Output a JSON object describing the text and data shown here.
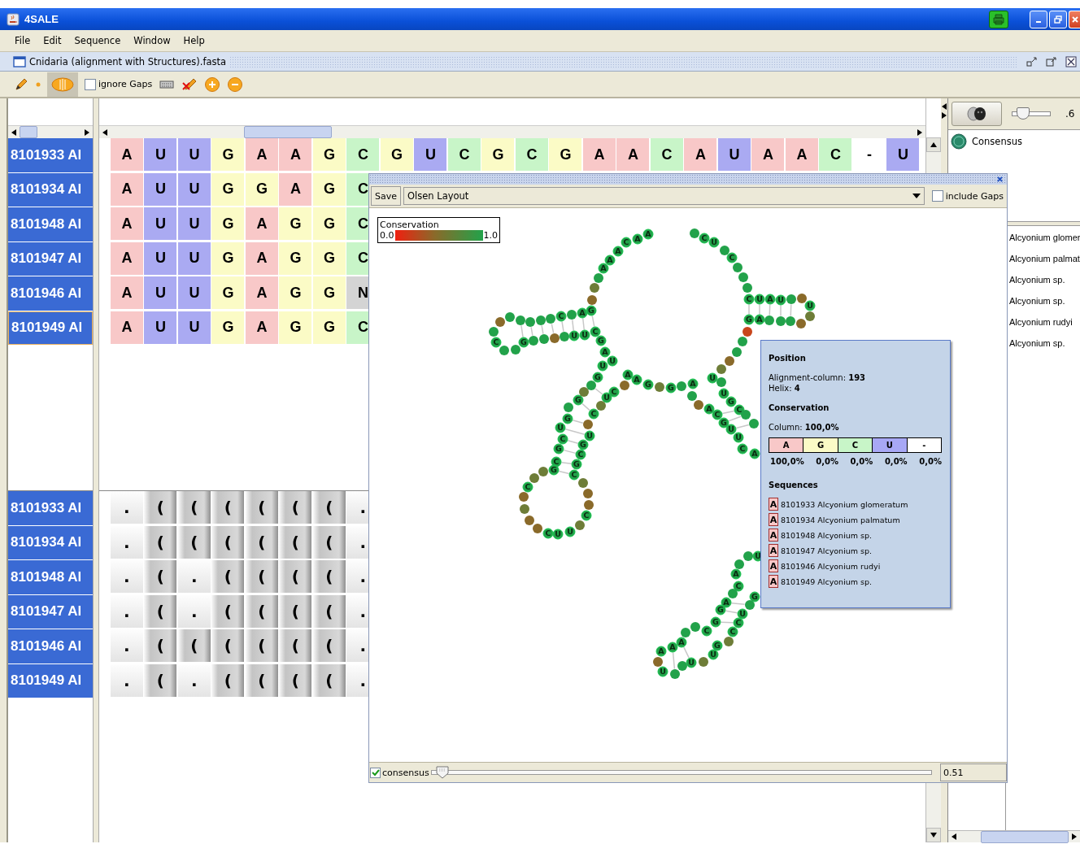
{
  "window": {
    "title": "4SALE"
  },
  "menu": [
    "File",
    "Edit",
    "Sequence",
    "Window",
    "Help"
  ],
  "document": {
    "title": "Cnidaria (alignment with Structures).fasta"
  },
  "toolbar": {
    "ignore_gaps": {
      "label": "ignore Gaps",
      "checked": false
    }
  },
  "sequences": [
    {
      "name": "8101933 Al",
      "selected": false,
      "cells": [
        {
          "base": "A",
          "color": "#f8c8c8"
        },
        {
          "base": "U",
          "color": "#aaaaf2"
        },
        {
          "base": "U",
          "color": "#aaaaf2"
        },
        {
          "base": "G",
          "color": "#fbfbc6"
        },
        {
          "base": "A",
          "color": "#f8c8c8"
        },
        {
          "base": "A",
          "color": "#f8c8c8"
        },
        {
          "base": "G",
          "color": "#fbfbc6"
        },
        {
          "base": "C",
          "color": "#c8f5c8"
        },
        {
          "base": "G",
          "color": "#fbfbc6"
        },
        {
          "base": "U",
          "color": "#aaaaf2"
        },
        {
          "base": "C",
          "color": "#c8f5c8"
        },
        {
          "base": "G",
          "color": "#fbfbc6"
        },
        {
          "base": "C",
          "color": "#c8f5c8"
        },
        {
          "base": "G",
          "color": "#fbfbc6"
        },
        {
          "base": "A",
          "color": "#f8c8c8"
        },
        {
          "base": "A",
          "color": "#f8c8c8"
        },
        {
          "base": "C",
          "color": "#c8f5c8"
        },
        {
          "base": "A",
          "color": "#f8c8c8"
        },
        {
          "base": "U",
          "color": "#aaaaf2"
        },
        {
          "base": "A",
          "color": "#f8c8c8"
        },
        {
          "base": "A",
          "color": "#f8c8c8"
        },
        {
          "base": "C",
          "color": "#c8f5c8"
        },
        {
          "base": "-",
          "color": "#ffffff"
        },
        {
          "base": "U",
          "color": "#aaaaf2"
        }
      ]
    },
    {
      "name": "8101934 Al",
      "selected": false,
      "cells": [
        {
          "base": "A",
          "color": "#f8c8c8"
        },
        {
          "base": "U",
          "color": "#aaaaf2"
        },
        {
          "base": "U",
          "color": "#aaaaf2"
        },
        {
          "base": "G",
          "color": "#fbfbc6"
        },
        {
          "base": "G",
          "color": "#fbfbc6"
        },
        {
          "base": "A",
          "color": "#f8c8c8"
        },
        {
          "base": "G",
          "color": "#fbfbc6"
        },
        {
          "base": "C",
          "color": "#c8f5c8"
        }
      ]
    },
    {
      "name": "8101948 Al",
      "selected": false,
      "cells": [
        {
          "base": "A",
          "color": "#f8c8c8"
        },
        {
          "base": "U",
          "color": "#aaaaf2"
        },
        {
          "base": "U",
          "color": "#aaaaf2"
        },
        {
          "base": "G",
          "color": "#fbfbc6"
        },
        {
          "base": "A",
          "color": "#f8c8c8"
        },
        {
          "base": "G",
          "color": "#fbfbc6"
        },
        {
          "base": "G",
          "color": "#fbfbc6"
        },
        {
          "base": "C",
          "color": "#c8f5c8"
        }
      ]
    },
    {
      "name": "8101947 Al",
      "selected": false,
      "cells": [
        {
          "base": "A",
          "color": "#f8c8c8"
        },
        {
          "base": "U",
          "color": "#aaaaf2"
        },
        {
          "base": "U",
          "color": "#aaaaf2"
        },
        {
          "base": "G",
          "color": "#fbfbc6"
        },
        {
          "base": "A",
          "color": "#f8c8c8"
        },
        {
          "base": "G",
          "color": "#fbfbc6"
        },
        {
          "base": "G",
          "color": "#fbfbc6"
        },
        {
          "base": "C",
          "color": "#c8f5c8"
        }
      ]
    },
    {
      "name": "8101946 Al",
      "selected": false,
      "cells": [
        {
          "base": "A",
          "color": "#f8c8c8"
        },
        {
          "base": "U",
          "color": "#aaaaf2"
        },
        {
          "base": "U",
          "color": "#aaaaf2"
        },
        {
          "base": "G",
          "color": "#fbfbc6"
        },
        {
          "base": "A",
          "color": "#f8c8c8"
        },
        {
          "base": "G",
          "color": "#fbfbc6"
        },
        {
          "base": "G",
          "color": "#fbfbc6"
        },
        {
          "base": "N",
          "color": "#d4d4d4"
        }
      ]
    },
    {
      "name": "8101949 Al",
      "selected": true,
      "cells": [
        {
          "base": "A",
          "color": "#f8c8c8"
        },
        {
          "base": "U",
          "color": "#aaaaf2"
        },
        {
          "base": "U",
          "color": "#aaaaf2"
        },
        {
          "base": "G",
          "color": "#fbfbc6"
        },
        {
          "base": "A",
          "color": "#f8c8c8"
        },
        {
          "base": "G",
          "color": "#fbfbc6"
        },
        {
          "base": "G",
          "color": "#fbfbc6"
        },
        {
          "base": "C",
          "color": "#c8f5c8"
        }
      ]
    }
  ],
  "structures": [
    {
      "name": "8101933 Al",
      "cells": [
        {
          "symbol": ".",
          "kind": "dot"
        },
        {
          "symbol": "(",
          "kind": "paren"
        },
        {
          "symbol": "(",
          "kind": "paren"
        },
        {
          "symbol": "(",
          "kind": "paren"
        },
        {
          "symbol": "(",
          "kind": "paren"
        },
        {
          "symbol": "(",
          "kind": "paren"
        },
        {
          "symbol": "(",
          "kind": "paren"
        },
        {
          "symbol": ".",
          "kind": "dot"
        }
      ]
    },
    {
      "name": "8101934 Al",
      "cells": [
        {
          "symbol": ".",
          "kind": "dot"
        },
        {
          "symbol": "(",
          "kind": "paren"
        },
        {
          "symbol": "(",
          "kind": "paren"
        },
        {
          "symbol": "(",
          "kind": "paren"
        },
        {
          "symbol": "(",
          "kind": "paren"
        },
        {
          "symbol": "(",
          "kind": "paren"
        },
        {
          "symbol": "(",
          "kind": "paren"
        },
        {
          "symbol": ".",
          "kind": "dot"
        }
      ]
    },
    {
      "name": "8101948 Al",
      "cells": [
        {
          "symbol": ".",
          "kind": "dot"
        },
        {
          "symbol": "(",
          "kind": "paren"
        },
        {
          "symbol": ".",
          "kind": "dot"
        },
        {
          "symbol": "(",
          "kind": "paren"
        },
        {
          "symbol": "(",
          "kind": "paren"
        },
        {
          "symbol": "(",
          "kind": "paren"
        },
        {
          "symbol": "(",
          "kind": "paren"
        },
        {
          "symbol": ".",
          "kind": "dot"
        }
      ]
    },
    {
      "name": "8101947 Al",
      "cells": [
        {
          "symbol": ".",
          "kind": "dot"
        },
        {
          "symbol": "(",
          "kind": "paren"
        },
        {
          "symbol": ".",
          "kind": "dot"
        },
        {
          "symbol": "(",
          "kind": "paren"
        },
        {
          "symbol": "(",
          "kind": "paren"
        },
        {
          "symbol": "(",
          "kind": "paren"
        },
        {
          "symbol": "(",
          "kind": "paren"
        },
        {
          "symbol": ".",
          "kind": "dot"
        }
      ]
    },
    {
      "name": "8101946 Al",
      "cells": [
        {
          "symbol": ".",
          "kind": "dot"
        },
        {
          "symbol": "(",
          "kind": "paren"
        },
        {
          "symbol": "(",
          "kind": "paren"
        },
        {
          "symbol": "(",
          "kind": "paren"
        },
        {
          "symbol": "(",
          "kind": "paren"
        },
        {
          "symbol": "(",
          "kind": "paren"
        },
        {
          "symbol": "(",
          "kind": "paren"
        },
        {
          "symbol": ".",
          "kind": "dot"
        }
      ]
    },
    {
      "name": "8101949 Al",
      "cells": [
        {
          "symbol": ".",
          "kind": "dot"
        },
        {
          "symbol": "(",
          "kind": "paren"
        },
        {
          "symbol": ".",
          "kind": "dot"
        },
        {
          "symbol": "(",
          "kind": "paren"
        },
        {
          "symbol": "(",
          "kind": "paren"
        },
        {
          "symbol": "(",
          "kind": "paren"
        },
        {
          "symbol": "(",
          "kind": "paren"
        },
        {
          "symbol": ".",
          "kind": "dot"
        }
      ]
    }
  ],
  "right_panel": {
    "slider": {
      "level": 0.2
    },
    "value": ".6",
    "consensus": "Consensus",
    "species": [
      "Alcyonium glomer",
      "Alcyonium palmat",
      "Alcyonium sp.",
      "Alcyonium sp.",
      "Alcyonium rudyi",
      "Alcyonium sp."
    ]
  },
  "structure_window": {
    "save": "Save",
    "layout": "Olsen Layout",
    "include_gaps": {
      "label": "include Gaps",
      "checked": false
    },
    "legend": {
      "title": "Conservation",
      "min": "0.0",
      "max": "1.0"
    },
    "nodes": [
      {
        "base": "C",
        "color": "#22a24a"
      },
      {
        "base": "A",
        "color": "#22a24a"
      },
      {
        "base": "A",
        "color": "#22a24a"
      },
      {
        "base": "C",
        "color": "#22a24a"
      },
      {
        "base": "U",
        "color": "#22a24a"
      },
      {
        "base": "A",
        "color": "#22a24a"
      },
      {
        "base": "A",
        "color": "#22a24a"
      },
      {
        "base": "C",
        "color": "#22a24a"
      },
      {
        "base": "A",
        "color": "#22a24a"
      },
      {
        "base": "C",
        "color": "#22a24a"
      },
      {
        "base": "U",
        "color": "#22a24a"
      },
      {
        "base": "A",
        "color": "#22a24a"
      },
      {
        "base": "U",
        "color": "#22a24a"
      },
      {
        "base": "U",
        "color": "#22a24a"
      },
      {
        "base": "C",
        "color": "#22a24a"
      },
      {
        "base": "A",
        "color": "#22a24a"
      },
      {
        "base": "G",
        "color": "#22a24a"
      },
      {
        "base": "G",
        "color": "#22a24a"
      },
      {
        "base": "A",
        "color": "#22a24a"
      },
      {
        "base": "C",
        "color": "#22a24a"
      },
      {
        "base": "G",
        "color": "#22a24a"
      },
      {
        "base": "U",
        "color": "#22a24a"
      },
      {
        "base": "U",
        "color": "#22a24a"
      },
      {
        "base": "C",
        "color": "#22a24a"
      },
      {
        "base": "G",
        "color": "#22a24a"
      },
      {
        "base": "A",
        "color": "#22a24a"
      },
      {
        "base": "U",
        "color": "#22a24a"
      },
      {
        "base": "U",
        "color": "#22a24a"
      },
      {
        "base": "G",
        "color": "#22a24a"
      },
      {
        "base": "A",
        "color": "#22a24a"
      },
      {
        "base": "A",
        "color": "#22a24a"
      },
      {
        "base": "G",
        "color": "#22a24a"
      },
      {
        "base": "G",
        "color": "#22a24a"
      },
      {
        "base": "A",
        "color": "#22a24a"
      },
      {
        "base": "U",
        "color": "#22a24a"
      },
      {
        "base": "G",
        "color": "#22a24a"
      },
      {
        "base": "U",
        "color": "#22a24a"
      },
      {
        "base": "C",
        "color": "#22a24a"
      },
      {
        "base": "U",
        "color": "#22a24a"
      },
      {
        "base": "G",
        "color": "#22a24a"
      },
      {
        "base": "G",
        "color": "#22a24a"
      },
      {
        "base": "C",
        "color": "#22a24a"
      },
      {
        "base": "A",
        "color": "#22a24a"
      },
      {
        "base": "C",
        "color": "#22a24a"
      },
      {
        "base": "C",
        "color": "#22a24a"
      },
      {
        "base": "U",
        "color": "#22a24a"
      },
      {
        "base": "G",
        "color": "#22a24a"
      },
      {
        "base": "U",
        "color": "#22a24a"
      },
      {
        "base": "C",
        "color": "#22a24a"
      },
      {
        "base": "U",
        "color": "#22a24a"
      },
      {
        "base": "U",
        "color": "#22a24a"
      },
      {
        "base": "G",
        "color": "#22a24a"
      },
      {
        "base": "G",
        "color": "#22a24a"
      },
      {
        "base": "C",
        "color": "#22a24a"
      },
      {
        "base": "C",
        "color": "#22a24a"
      },
      {
        "base": "A",
        "color": "#22a24a"
      },
      {
        "base": "C",
        "color": "#22a24a"
      },
      {
        "base": "G",
        "color": "#22a24a"
      },
      {
        "base": "G",
        "color": "#22a24a"
      },
      {
        "base": "C",
        "color": "#22a24a"
      },
      {
        "base": "C",
        "color": "#22a24a"
      },
      {
        "base": "C",
        "color": "#22a24a"
      },
      {
        "base": "C",
        "color": "#22a24a"
      },
      {
        "base": "U",
        "color": "#22a24a"
      },
      {
        "base": "U",
        "color": "#22a24a"
      },
      {
        "base": "U",
        "color": "#22a24a"
      },
      {
        "base": "A",
        "color": "#22a24a"
      },
      {
        "base": "C",
        "color": "#22a24a"
      },
      {
        "base": "A",
        "color": "#22a24a"
      },
      {
        "base": "G",
        "color": "#22a24a"
      },
      {
        "base": "G",
        "color": "#22a24a"
      },
      {
        "base": "U",
        "color": "#22a24a"
      },
      {
        "base": "G",
        "color": "#22a24a"
      },
      {
        "base": "C",
        "color": "#22a24a"
      },
      {
        "base": "C",
        "color": "#22a24a"
      },
      {
        "base": "C",
        "color": "#22a24a"
      },
      {
        "base": "A",
        "color": "#22a24a"
      },
      {
        "base": "A",
        "color": "#22a24a"
      },
      {
        "base": "A",
        "color": "#22a24a"
      },
      {
        "base": "G",
        "color": "#22a24a"
      },
      {
        "base": "U",
        "color": "#22a24a"
      },
      {
        "base": "U",
        "color": "#22a24a"
      },
      {
        "base": "U",
        "color": "#22a24a"
      },
      {
        "color": "#22a24a"
      },
      {
        "color": "#6e7d38"
      },
      {
        "color": "#8a6a2a"
      },
      {
        "color": "#22a24a"
      },
      {
        "color": "#22a24a"
      },
      {
        "color": "#22a24a"
      },
      {
        "color": "#22a24a"
      },
      {
        "color": "#22a24a"
      },
      {
        "color": "#22a24a"
      },
      {
        "color": "#8a6a2a"
      },
      {
        "color": "#22a24a"
      },
      {
        "color": "#22a24a"
      },
      {
        "color": "#22a24a"
      },
      {
        "color": "#22a24a"
      },
      {
        "color": "#22a24a"
      },
      {
        "color": "#8a6a2a"
      },
      {
        "color": "#22a24a"
      },
      {
        "color": "#22a24a"
      },
      {
        "color": "#6e7d38"
      },
      {
        "color": "#22a24a"
      },
      {
        "color": "#6e7d38"
      },
      {
        "color": "#6e7d38"
      },
      {
        "color": "#8a6a2a"
      },
      {
        "color": "#6e7d38"
      },
      {
        "color": "#8a6a2a"
      },
      {
        "color": "#8a6a2a"
      },
      {
        "color": "#6e7d38"
      },
      {
        "color": "#8a6a2a"
      },
      {
        "color": "#8a6a2a"
      },
      {
        "color": "#6e7d38"
      },
      {
        "color": "#8a6a2a"
      },
      {
        "color": "#6e7d38"
      },
      {
        "color": "#8a6a2a"
      },
      {
        "color": "#6e7d38"
      },
      {
        "color": "#22a24a"
      },
      {
        "color": "#22a24a"
      },
      {
        "color": "#8a6a2a"
      },
      {
        "color": "#22a24a"
      },
      {
        "color": "#22a24a"
      },
      {
        "color": "#22a24a"
      },
      {
        "color": "#6e7d38"
      },
      {
        "color": "#8a6a2a"
      },
      {
        "color": "#22a24a"
      },
      {
        "color": "#22a24a"
      },
      {
        "color": "#c8461c"
      },
      {
        "color": "#22a24a"
      },
      {
        "color": "#22a24a"
      },
      {
        "color": "#22a24a"
      },
      {
        "color": "#8a6a2a"
      },
      {
        "color": "#6e7d38"
      },
      {
        "color": "#8a6a2a"
      },
      {
        "color": "#22a24a"
      },
      {
        "color": "#22a24a"
      },
      {
        "color": "#22a24a"
      },
      {
        "color": "#22a24a"
      },
      {
        "color": "#22a24a"
      },
      {
        "color": "#22a24a"
      },
      {
        "color": "#22a24a"
      },
      {
        "color": "#22a24a"
      },
      {
        "color": "#22a24a"
      },
      {
        "color": "#22a24a"
      },
      {
        "color": "#22a24a"
      },
      {
        "color": "#8a6a2a"
      },
      {
        "color": "#22a24a"
      },
      {
        "color": "#22a24a"
      },
      {
        "color": "#6e7d38"
      },
      {
        "color": "#6e7d38"
      },
      {
        "color": "#22a24a"
      }
    ],
    "consensus": {
      "label": "consensus",
      "checked": true
    },
    "threshold": {
      "level": 0.01,
      "value": "0.51"
    }
  },
  "tooltip": {
    "position_title": "Position",
    "column": "Alignment-column: **193**",
    "helix": "Helix: **4**",
    "conservation_title": "Conservation",
    "column_value": "Column: **100,0%**",
    "bars": [
      {
        "base": "A",
        "color": "#f8c8c8",
        "percent": "100,0%"
      },
      {
        "base": "G",
        "color": "#fbfbc6",
        "percent": "0,0%"
      },
      {
        "base": "C",
        "color": "#c8f5c8",
        "percent": "0,0%"
      },
      {
        "base": "U",
        "color": "#a8a8f5",
        "percent": "0,0%"
      },
      {
        "base": "-",
        "color": "#ffffff",
        "percent": "0,0%"
      }
    ],
    "sequences_title": "Sequences",
    "sequences": [
      {
        "base": "A",
        "label": "8101933 Alcyonium glomeratum"
      },
      {
        "base": "A",
        "label": "8101934 Alcyonium palmatum"
      },
      {
        "base": "A",
        "label": "8101948 Alcyonium sp."
      },
      {
        "base": "A",
        "label": "8101947 Alcyonium sp."
      },
      {
        "base": "A",
        "label": "8101946 Alcyonium rudyi"
      },
      {
        "base": "A",
        "label": "8101949 Alcyonium sp."
      }
    ]
  }
}
